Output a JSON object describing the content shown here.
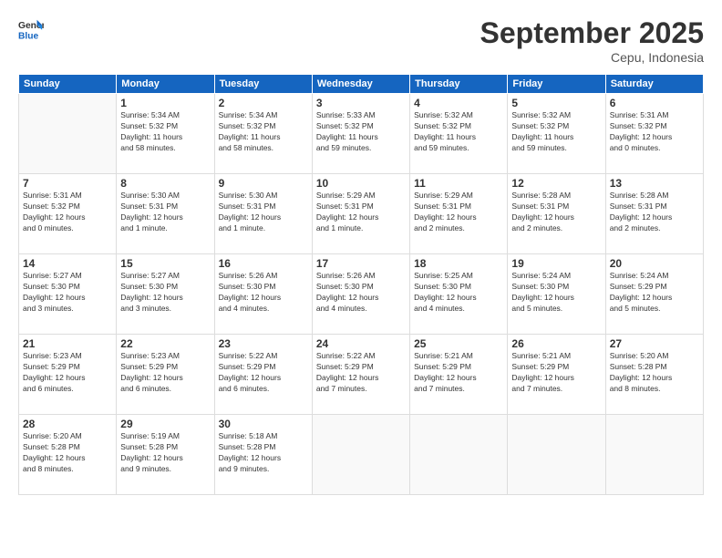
{
  "header": {
    "logo_general": "General",
    "logo_blue": "Blue",
    "month_title": "September 2025",
    "subtitle": "Cepu, Indonesia"
  },
  "days_of_week": [
    "Sunday",
    "Monday",
    "Tuesday",
    "Wednesday",
    "Thursday",
    "Friday",
    "Saturday"
  ],
  "weeks": [
    [
      {
        "day": "",
        "info": ""
      },
      {
        "day": "1",
        "info": "Sunrise: 5:34 AM\nSunset: 5:32 PM\nDaylight: 11 hours\nand 58 minutes."
      },
      {
        "day": "2",
        "info": "Sunrise: 5:34 AM\nSunset: 5:32 PM\nDaylight: 11 hours\nand 58 minutes."
      },
      {
        "day": "3",
        "info": "Sunrise: 5:33 AM\nSunset: 5:32 PM\nDaylight: 11 hours\nand 59 minutes."
      },
      {
        "day": "4",
        "info": "Sunrise: 5:32 AM\nSunset: 5:32 PM\nDaylight: 11 hours\nand 59 minutes."
      },
      {
        "day": "5",
        "info": "Sunrise: 5:32 AM\nSunset: 5:32 PM\nDaylight: 11 hours\nand 59 minutes."
      },
      {
        "day": "6",
        "info": "Sunrise: 5:31 AM\nSunset: 5:32 PM\nDaylight: 12 hours\nand 0 minutes."
      }
    ],
    [
      {
        "day": "7",
        "info": "Sunrise: 5:31 AM\nSunset: 5:32 PM\nDaylight: 12 hours\nand 0 minutes."
      },
      {
        "day": "8",
        "info": "Sunrise: 5:30 AM\nSunset: 5:31 PM\nDaylight: 12 hours\nand 1 minute."
      },
      {
        "day": "9",
        "info": "Sunrise: 5:30 AM\nSunset: 5:31 PM\nDaylight: 12 hours\nand 1 minute."
      },
      {
        "day": "10",
        "info": "Sunrise: 5:29 AM\nSunset: 5:31 PM\nDaylight: 12 hours\nand 1 minute."
      },
      {
        "day": "11",
        "info": "Sunrise: 5:29 AM\nSunset: 5:31 PM\nDaylight: 12 hours\nand 2 minutes."
      },
      {
        "day": "12",
        "info": "Sunrise: 5:28 AM\nSunset: 5:31 PM\nDaylight: 12 hours\nand 2 minutes."
      },
      {
        "day": "13",
        "info": "Sunrise: 5:28 AM\nSunset: 5:31 PM\nDaylight: 12 hours\nand 2 minutes."
      }
    ],
    [
      {
        "day": "14",
        "info": "Sunrise: 5:27 AM\nSunset: 5:30 PM\nDaylight: 12 hours\nand 3 minutes."
      },
      {
        "day": "15",
        "info": "Sunrise: 5:27 AM\nSunset: 5:30 PM\nDaylight: 12 hours\nand 3 minutes."
      },
      {
        "day": "16",
        "info": "Sunrise: 5:26 AM\nSunset: 5:30 PM\nDaylight: 12 hours\nand 4 minutes."
      },
      {
        "day": "17",
        "info": "Sunrise: 5:26 AM\nSunset: 5:30 PM\nDaylight: 12 hours\nand 4 minutes."
      },
      {
        "day": "18",
        "info": "Sunrise: 5:25 AM\nSunset: 5:30 PM\nDaylight: 12 hours\nand 4 minutes."
      },
      {
        "day": "19",
        "info": "Sunrise: 5:24 AM\nSunset: 5:30 PM\nDaylight: 12 hours\nand 5 minutes."
      },
      {
        "day": "20",
        "info": "Sunrise: 5:24 AM\nSunset: 5:29 PM\nDaylight: 12 hours\nand 5 minutes."
      }
    ],
    [
      {
        "day": "21",
        "info": "Sunrise: 5:23 AM\nSunset: 5:29 PM\nDaylight: 12 hours\nand 6 minutes."
      },
      {
        "day": "22",
        "info": "Sunrise: 5:23 AM\nSunset: 5:29 PM\nDaylight: 12 hours\nand 6 minutes."
      },
      {
        "day": "23",
        "info": "Sunrise: 5:22 AM\nSunset: 5:29 PM\nDaylight: 12 hours\nand 6 minutes."
      },
      {
        "day": "24",
        "info": "Sunrise: 5:22 AM\nSunset: 5:29 PM\nDaylight: 12 hours\nand 7 minutes."
      },
      {
        "day": "25",
        "info": "Sunrise: 5:21 AM\nSunset: 5:29 PM\nDaylight: 12 hours\nand 7 minutes."
      },
      {
        "day": "26",
        "info": "Sunrise: 5:21 AM\nSunset: 5:29 PM\nDaylight: 12 hours\nand 7 minutes."
      },
      {
        "day": "27",
        "info": "Sunrise: 5:20 AM\nSunset: 5:28 PM\nDaylight: 12 hours\nand 8 minutes."
      }
    ],
    [
      {
        "day": "28",
        "info": "Sunrise: 5:20 AM\nSunset: 5:28 PM\nDaylight: 12 hours\nand 8 minutes."
      },
      {
        "day": "29",
        "info": "Sunrise: 5:19 AM\nSunset: 5:28 PM\nDaylight: 12 hours\nand 9 minutes."
      },
      {
        "day": "30",
        "info": "Sunrise: 5:18 AM\nSunset: 5:28 PM\nDaylight: 12 hours\nand 9 minutes."
      },
      {
        "day": "",
        "info": ""
      },
      {
        "day": "",
        "info": ""
      },
      {
        "day": "",
        "info": ""
      },
      {
        "day": "",
        "info": ""
      }
    ]
  ]
}
